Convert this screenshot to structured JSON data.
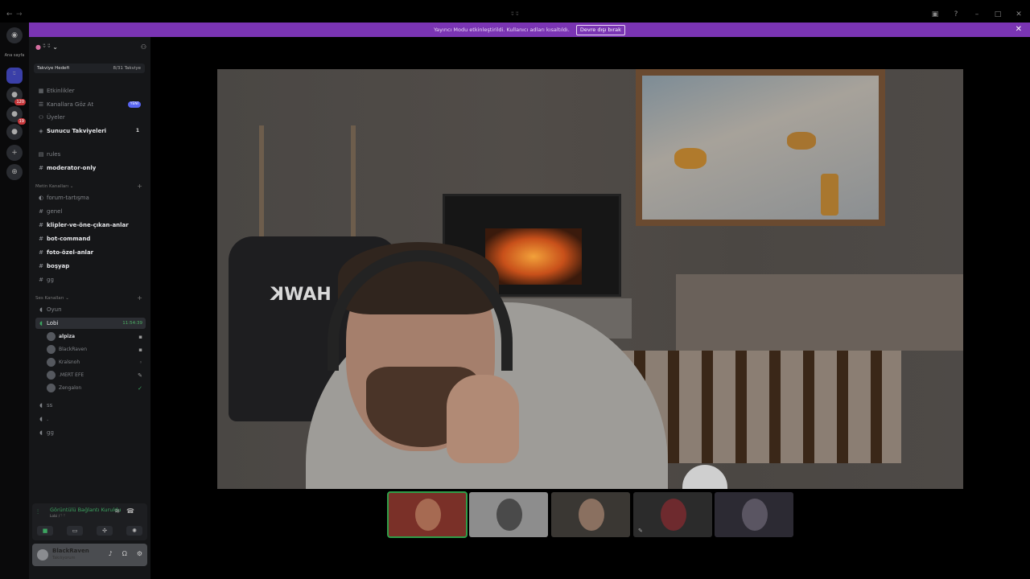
{
  "titlebar": {
    "title": "ᵕ̈ ᵕ̈",
    "back": "←",
    "forward": "→"
  },
  "banner": {
    "text": "Yayıncı Modu etkinleştirildi. Kullanıcı adları kısaltıldı.",
    "button": "Devre dışı bırak",
    "close": "✕"
  },
  "servers": {
    "home_label": "Ana sayfa",
    "badges": [
      "120",
      "19"
    ],
    "add": "+",
    "discover": "⊕"
  },
  "guild": {
    "name": "ᵕ̈ ᵕ̈ ⌄",
    "boost_goal": "Takviye Hedefi",
    "boost_count": "8/31 Takviye"
  },
  "channels": {
    "events": "Etkinlikler",
    "browse": "Kanallara Göz At",
    "browse_pill": "YENİ",
    "members": "Üyeler",
    "boosts": "Sunucu Takviyeleri",
    "boosts_count": "1",
    "rules": "rules",
    "moderator": "moderator-only",
    "text_category": "Metin Kanalları",
    "forum": "forum-tartışma",
    "genel": "genel",
    "klipler": "klipler-ve-öne-çıkan-anlar",
    "bot": "bot-command",
    "foto": "foto-özel-anlar",
    "bosyap": "boşyap",
    "gg": "gg",
    "voice_category": "Ses Kanalları",
    "oyun": "Oyun",
    "lobi": "Lobi",
    "lobi_time": "11:54:39",
    "ss": "ss",
    "dot": ".",
    "gg2": "gg"
  },
  "voice_users": [
    "alpiza",
    "BlackRaven",
    "Kralsnoh",
    ".MERT EFE",
    "Zengalon"
  ],
  "voicebar": {
    "title": "Görüntülü Bağlantı Kuruldu",
    "subtitle": "Lobi / ᵕ̈ ᵕ̈"
  },
  "user": {
    "name": "BlackRaven",
    "status": "Takılıyorum"
  },
  "stage": {
    "chair_brand": "HAWK"
  },
  "colors": {
    "accent": "#5865f2",
    "banner": "#7a34b3",
    "voice_green": "#3ca560"
  }
}
